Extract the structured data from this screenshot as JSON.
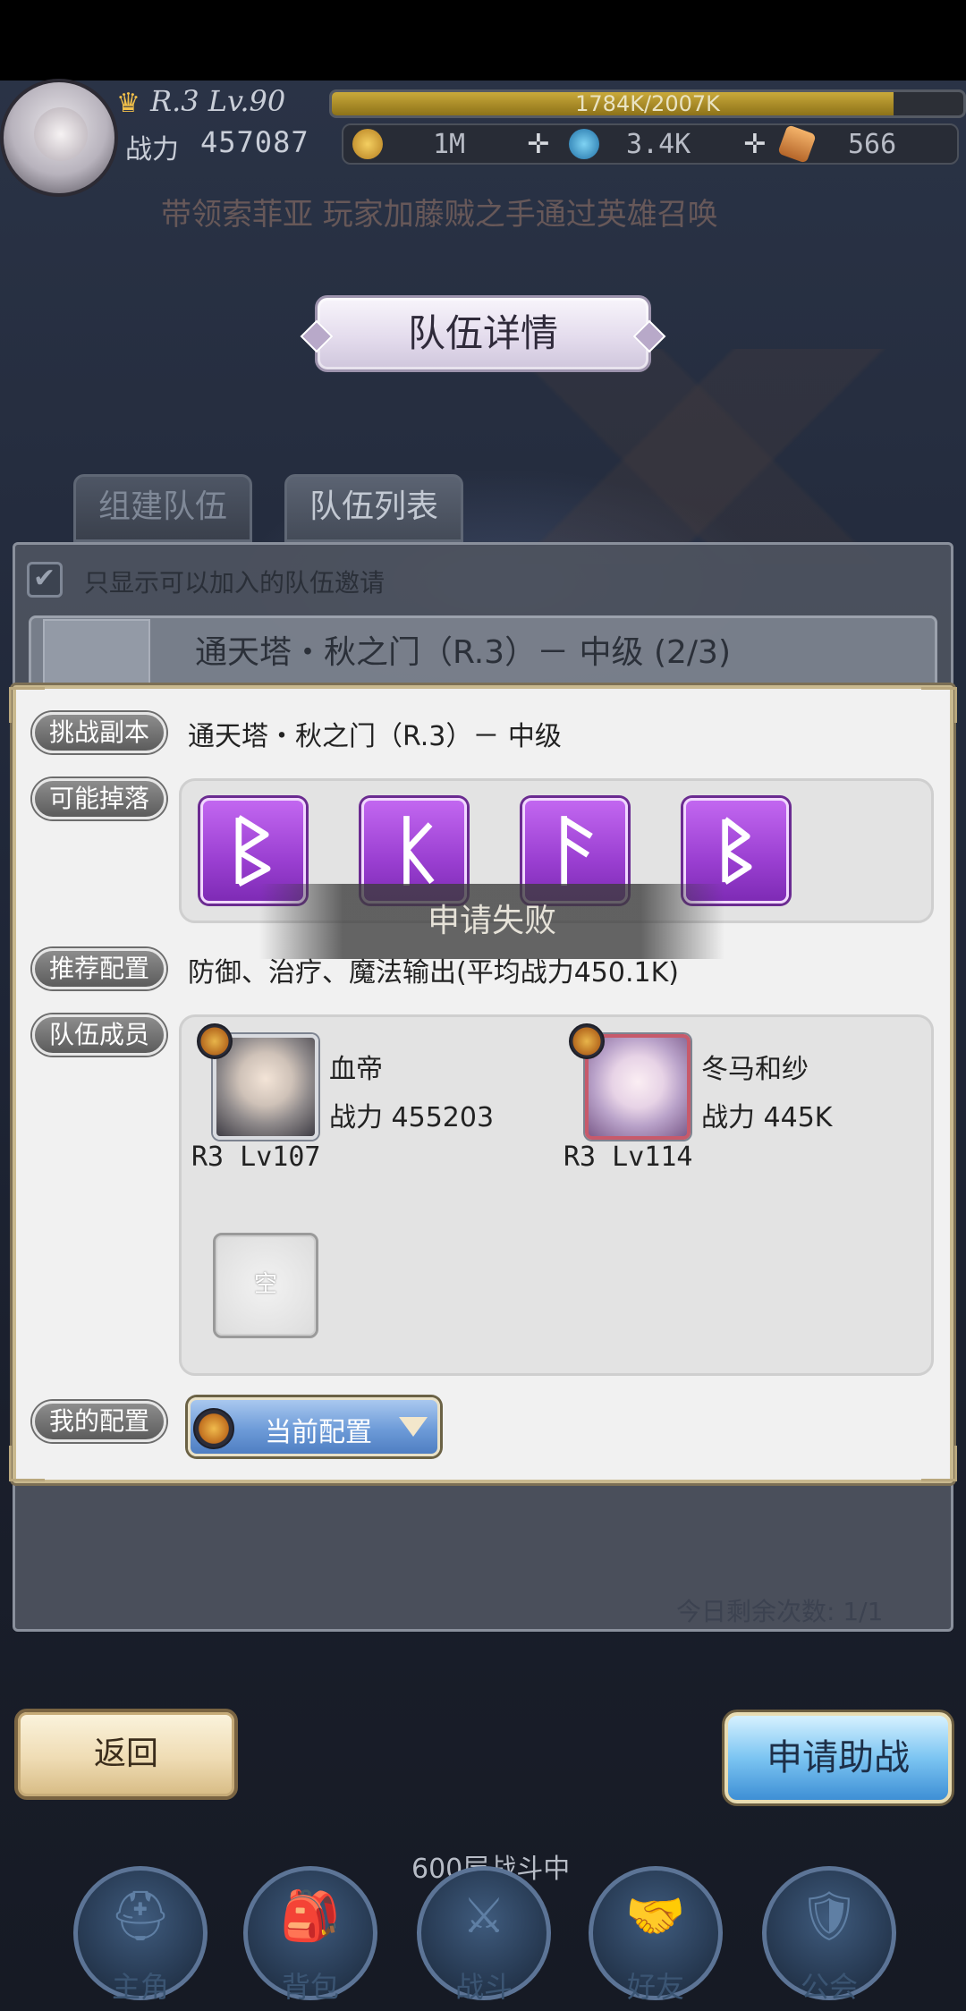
{
  "header": {
    "level": "R.3 Lv.90",
    "exp": "1784K/2007K",
    "exp_fraction": 0.889,
    "power_label": "战力",
    "power_value": "457087",
    "resources": [
      {
        "icon": "gold-coin-icon",
        "value": "1M"
      },
      {
        "icon": "blue-gem-icon",
        "value": "3.4K"
      },
      {
        "icon": "orange-crystal-icon",
        "value": "566"
      }
    ],
    "marquee": "带领索菲亚   玩家加藤贼之手通过英雄召唤"
  },
  "page_title": "队伍详情",
  "tabs": [
    {
      "label": "组建队伍"
    },
    {
      "label": "队伍列表"
    }
  ],
  "list": {
    "filter_label": "只显示可以加入的队伍邀请",
    "row_title": "通天塔・秋之门（R.3）－ 中级 (2/3)",
    "remaining": "今日剩余次数: 1/1"
  },
  "modal": {
    "challenge_label": "挑战副本",
    "challenge_value": "通天塔・秋之门（R.3）－ 中级",
    "drops_label": "可能掉落",
    "drops": [
      {
        "icon": "rune-berkano-icon"
      },
      {
        "icon": "rune-hagalaz-icon"
      },
      {
        "icon": "rune-fehu-icon"
      },
      {
        "icon": "rune-berkano-small-icon"
      }
    ],
    "recommend_label": "推荐配置",
    "recommend_value": "防御、治疗、魔法输出(平均战力450.1K)",
    "members_label": "队伍成员",
    "members": [
      {
        "name": "血帝",
        "power": "战力 455203",
        "level": "R3 Lv107"
      },
      {
        "name": "冬马和纱",
        "power": "战力 445K",
        "level": "R3 Lv114"
      }
    ],
    "empty_slot": "空",
    "my_config_label": "我的配置",
    "my_config_value": "当前配置"
  },
  "toast": "申请失败",
  "buttons": {
    "back": "返回",
    "apply": "申请助战"
  },
  "battle_floor": "600层战斗中",
  "nav": [
    {
      "label": "主角",
      "icon": "helmet-icon"
    },
    {
      "label": "背包",
      "icon": "backpack-icon"
    },
    {
      "label": "战斗",
      "icon": "crossed-swords-icon"
    },
    {
      "label": "好友",
      "icon": "handshake-icon"
    },
    {
      "label": "公会",
      "icon": "guild-shield-icon"
    }
  ],
  "colors": {
    "rune_purple": "#9a3fd1",
    "apply_blue": "#7cc5f2",
    "back_beige": "#efdcb4",
    "modal_bg": "#f1f1f1"
  }
}
